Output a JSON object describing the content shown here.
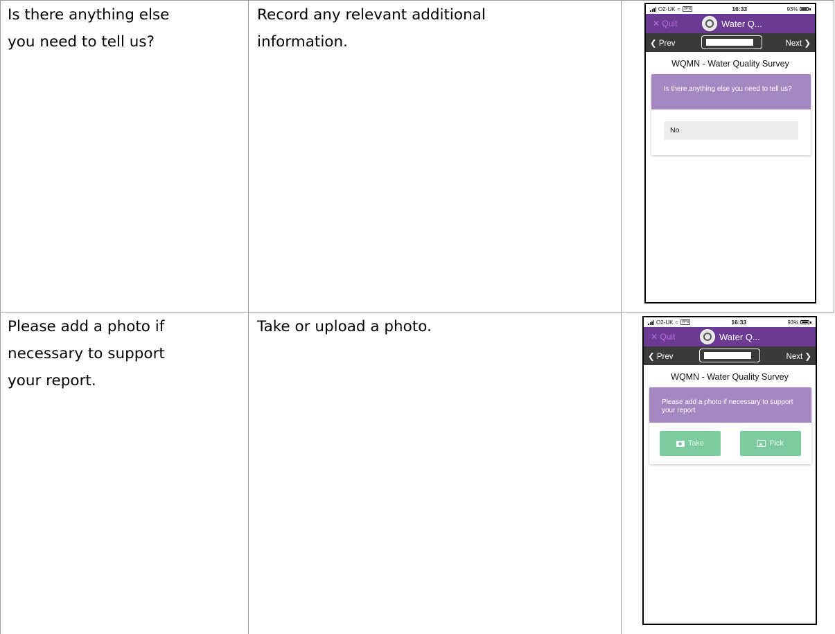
{
  "rows": [
    {
      "question": [
        "Is there anything else",
        "you need to tell us?"
      ],
      "instruction": [
        "Record any relevant additional",
        "information."
      ],
      "phone": {
        "status": {
          "carrier": "O2-UK",
          "vpn": "VPN",
          "time": "16:33",
          "battery": "93%"
        },
        "quit": "✕ Quit",
        "app_title": "Water Q...",
        "prev": "❮ Prev",
        "next": "Next ❯",
        "survey_title": "WQMN - Water Quality Survey",
        "card_question": "Is there anything else you need to tell us?",
        "answer": "No"
      }
    },
    {
      "question": [
        "Please add a photo if",
        "necessary to support",
        "your report."
      ],
      "instruction": [
        "Take or upload a photo."
      ],
      "phone": {
        "status": {
          "carrier": "O2-UK",
          "vpn": "VPN",
          "time": "16:33",
          "battery": "93%"
        },
        "quit": "✕ Quit",
        "app_title": "Water Q...",
        "prev": "❮ Prev",
        "next": "Next ❯",
        "survey_title": "WQMN - Water Quality Survey",
        "card_question": "Please add a photo if necessary to support your report",
        "take_label": "Take",
        "pick_label": "Pick"
      }
    }
  ],
  "colors": {
    "titlebar": "#6b3a93",
    "quit": "#b86be0",
    "navbar": "#3a3a3a",
    "card_head": "#a588c2",
    "photo_button": "#7ccaa0"
  }
}
